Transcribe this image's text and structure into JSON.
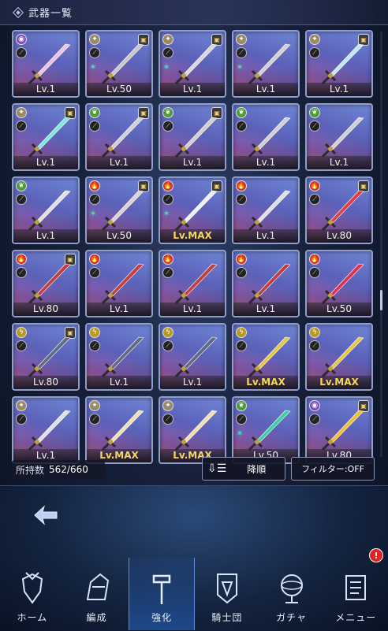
{
  "header": {
    "title": "武器一覧"
  },
  "grid": {
    "cards": [
      {
        "attr": "eye",
        "lock": false,
        "gem": false,
        "level": "Lv.1",
        "max": false,
        "blade": "#f0c0e0"
      },
      {
        "attr": "star",
        "lock": true,
        "gem": true,
        "level": "Lv.50",
        "max": false,
        "blade": "#c8c8c8"
      },
      {
        "attr": "star",
        "lock": true,
        "gem": true,
        "level": "Lv.1",
        "max": false,
        "blade": "#d8d8d8"
      },
      {
        "attr": "star",
        "lock": false,
        "gem": true,
        "level": "Lv.1",
        "max": false,
        "blade": "#d0d0d0"
      },
      {
        "attr": "star",
        "lock": true,
        "gem": false,
        "level": "Lv.1",
        "max": false,
        "blade": "#bfe8f0"
      },
      {
        "attr": "star",
        "lock": true,
        "gem": false,
        "level": "Lv.1",
        "max": false,
        "blade": "#7fe8e0"
      },
      {
        "attr": "nature",
        "lock": true,
        "gem": false,
        "level": "Lv.1",
        "max": false,
        "blade": "#d0d0d0"
      },
      {
        "attr": "nature",
        "lock": true,
        "gem": false,
        "level": "Lv.1",
        "max": false,
        "blade": "#d0d0d0"
      },
      {
        "attr": "nature",
        "lock": false,
        "gem": false,
        "level": "Lv.1",
        "max": false,
        "blade": "#d0d0d0"
      },
      {
        "attr": "nature",
        "lock": false,
        "gem": false,
        "level": "Lv.1",
        "max": false,
        "blade": "#d0d0d0"
      },
      {
        "attr": "nature",
        "lock": false,
        "gem": false,
        "level": "Lv.1",
        "max": false,
        "blade": "#e0e0e0"
      },
      {
        "attr": "fire",
        "lock": true,
        "gem": true,
        "level": "Lv.50",
        "max": false,
        "blade": "#e0d0d0"
      },
      {
        "attr": "fire",
        "lock": true,
        "gem": true,
        "level": "Lv.MAX",
        "max": true,
        "blade": "#f0f0f0"
      },
      {
        "attr": "fire",
        "lock": false,
        "gem": false,
        "level": "Lv.1",
        "max": false,
        "blade": "#e0e0e0"
      },
      {
        "attr": "fire",
        "lock": true,
        "gem": false,
        "level": "Lv.80",
        "max": false,
        "blade": "#e04040"
      },
      {
        "attr": "fire",
        "lock": true,
        "gem": false,
        "level": "Lv.80",
        "max": false,
        "blade": "#c04040"
      },
      {
        "attr": "fire",
        "lock": false,
        "gem": false,
        "level": "Lv.1",
        "max": false,
        "blade": "#c04040"
      },
      {
        "attr": "fire",
        "lock": false,
        "gem": false,
        "level": "Lv.1",
        "max": false,
        "blade": "#c04040"
      },
      {
        "attr": "fire",
        "lock": false,
        "gem": false,
        "level": "Lv.1",
        "max": false,
        "blade": "#c04040"
      },
      {
        "attr": "fire",
        "lock": false,
        "gem": false,
        "level": "Lv.50",
        "max": false,
        "blade": "#e03050"
      },
      {
        "attr": "thunder",
        "lock": true,
        "gem": false,
        "level": "Lv.80",
        "max": false,
        "blade": "#606a80"
      },
      {
        "attr": "thunder",
        "lock": false,
        "gem": false,
        "level": "Lv.1",
        "max": false,
        "blade": "#606a80"
      },
      {
        "attr": "thunder",
        "lock": false,
        "gem": false,
        "level": "Lv.1",
        "max": false,
        "blade": "#606a80"
      },
      {
        "attr": "thunder",
        "lock": false,
        "gem": false,
        "level": "Lv.MAX",
        "max": true,
        "blade": "#e8c840"
      },
      {
        "attr": "thunder",
        "lock": false,
        "gem": false,
        "level": "Lv.MAX",
        "max": true,
        "blade": "#e8c840"
      },
      {
        "attr": "star",
        "lock": false,
        "gem": false,
        "level": "Lv.1",
        "max": false,
        "blade": "#e0e0e0"
      },
      {
        "attr": "star",
        "lock": false,
        "gem": false,
        "level": "Lv.MAX",
        "max": true,
        "blade": "#f0e0b0"
      },
      {
        "attr": "star",
        "lock": false,
        "gem": false,
        "level": "Lv.MAX",
        "max": true,
        "blade": "#f0e0b0"
      },
      {
        "attr": "nature",
        "lock": false,
        "gem": true,
        "level": "Lv.50",
        "max": false,
        "blade": "#40d0a0"
      },
      {
        "attr": "eye",
        "lock": true,
        "gem": false,
        "level": "Lv.80",
        "max": false,
        "blade": "#f0c030"
      }
    ]
  },
  "inventory": {
    "label": "所持数",
    "value": "562/660"
  },
  "sort": {
    "label": "降順",
    "icon": "sort-descending-icon"
  },
  "filter": {
    "label": "フィルター:OFF"
  },
  "back": {
    "icon": "back-arrow-icon"
  },
  "nav": {
    "items": [
      {
        "label": "ホーム",
        "icon": "home-crest-icon",
        "active": false
      },
      {
        "label": "編成",
        "icon": "knight-helmet-icon",
        "active": false
      },
      {
        "label": "強化",
        "icon": "hammer-icon",
        "active": true
      },
      {
        "label": "騎士団",
        "icon": "banner-shield-icon",
        "active": false
      },
      {
        "label": "ガチャ",
        "icon": "armillary-sphere-icon",
        "active": false
      },
      {
        "label": "メニュー",
        "icon": "menu-scroll-icon",
        "active": false
      }
    ],
    "badge": "!"
  }
}
